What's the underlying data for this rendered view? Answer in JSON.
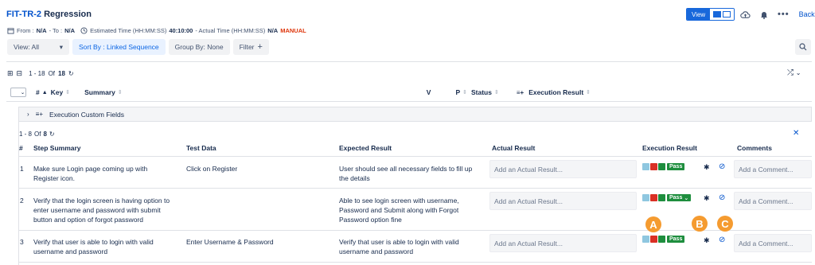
{
  "header": {
    "key": "FIT-TR-2",
    "name": "Regression",
    "from_label": "From :",
    "from_value": "N/A",
    "to_label": "- To :",
    "to_value": "N/A",
    "estimated_label": "Estimated Time (HH:MM:SS)",
    "estimated_value": "40:10:00",
    "actual_label": "- Actual Time (HH:MM:SS)",
    "actual_value": "N/A",
    "mode": "MANUAL",
    "view_label": "View",
    "back_label": "Back"
  },
  "toolbar": {
    "view_select": "View: All",
    "sort_by": "Sort By : Linked Sequence",
    "group_by": "Group By: None",
    "filter": "Filter"
  },
  "list": {
    "range": "1 - 18",
    "of_label": "Of",
    "total": "18",
    "columns": [
      "#",
      "Key",
      "Summary",
      "V",
      "P",
      "Status",
      "Execution Result"
    ]
  },
  "custom_fields": {
    "label": "Execution Custom Fields"
  },
  "steps": {
    "range": "1 - 8",
    "of_label": "Of",
    "total": "8",
    "columns": [
      "#",
      "Step Summary",
      "Test Data",
      "Expected Result",
      "Actual Result",
      "Execution Result",
      "Comments"
    ],
    "actual_placeholder": "Add an Actual Result...",
    "comment_placeholder": "Add a Comment...",
    "rows": [
      {
        "num": "1",
        "summary": [
          "Make sure Login page coming up with",
          "Register icon."
        ],
        "test_data": "Click on Register",
        "expected": [
          "User should see all necessary fields to fill up",
          "the details"
        ],
        "result": "Pass"
      },
      {
        "num": "2",
        "summary": [
          "Verify that the login screen is having option to",
          "enter username and password with submit",
          "button and option of forgot password"
        ],
        "test_data": "",
        "expected": [
          "Able to see login screen with username,",
          "Password and Submit along with Forgot",
          "Password option fine"
        ],
        "result": "Pass"
      },
      {
        "num": "3",
        "summary": [
          "Verify that user is able to login with valid",
          "username and password"
        ],
        "test_data": "Enter Username & Password",
        "expected": [
          "Verify that user is able to login with valid",
          "username and password"
        ],
        "result": "Pass"
      }
    ]
  },
  "colors": {
    "status_blue": "#8fc7e0",
    "status_red": "#d93025",
    "status_green": "#1e8e3e",
    "badge_orange": "#f59b30"
  },
  "annotations": [
    "A",
    "B",
    "C"
  ]
}
